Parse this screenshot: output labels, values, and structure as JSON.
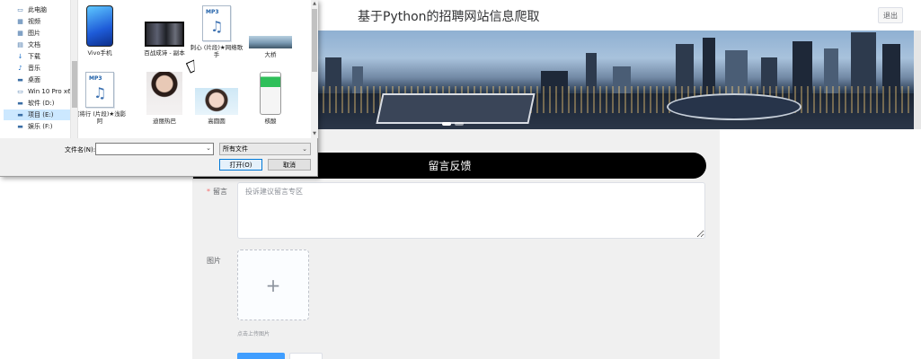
{
  "page": {
    "title": "基于Python的招聘网站信息爬取",
    "logout_label": "退出",
    "feedback_header": "留言反馈",
    "message_label": "留言",
    "required_mark": "*",
    "message_placeholder": "投诉建议留言专区",
    "image_label": "图片",
    "upload_plus": "+",
    "upload_hint": "点击上传图片",
    "banner": {
      "slides": 2,
      "active_slide": 1
    }
  },
  "dialog": {
    "nav_items": [
      {
        "label": "此电脑",
        "icon": "computer-icon",
        "glyph": "▭"
      },
      {
        "label": "视频",
        "icon": "video-folder-icon",
        "glyph": "▦"
      },
      {
        "label": "图片",
        "icon": "pictures-folder-icon",
        "glyph": "▦"
      },
      {
        "label": "文档",
        "icon": "documents-folder-icon",
        "glyph": "▤"
      },
      {
        "label": "下载",
        "icon": "download-icon",
        "glyph": "↓"
      },
      {
        "label": "音乐",
        "icon": "music-icon",
        "glyph": "♪"
      },
      {
        "label": "桌面",
        "icon": "desktop-icon",
        "glyph": "▬"
      },
      {
        "label": "Win 10 Pro x64",
        "icon": "drive-icon",
        "glyph": "▭"
      },
      {
        "label": "软件 (D:)",
        "icon": "drive-icon",
        "glyph": "▬"
      },
      {
        "label": "项目 (E:)",
        "icon": "drive-icon",
        "glyph": "▬"
      },
      {
        "label": "娱乐 (F:)",
        "icon": "drive-icon",
        "glyph": "▬"
      }
    ],
    "selected_nav": "项目 (E:)",
    "files": [
      {
        "name": "Vivo手机",
        "kind": "image-phone"
      },
      {
        "name": "百战成诗 - 副本",
        "kind": "image-video"
      },
      {
        "name": "刺心 (片段)★网络歌手",
        "kind": "mp3"
      },
      {
        "name": "大桥",
        "kind": "image-bridge"
      },
      {
        "name": "盗将行 (片段)★浅影阿",
        "kind": "mp3"
      },
      {
        "name": "迪丽热巴",
        "kind": "image-portrait"
      },
      {
        "name": "高圆圆",
        "kind": "image-portrait2"
      },
      {
        "name": "核酸",
        "kind": "image-phone-green"
      }
    ],
    "filename_label": "文件名(N):",
    "filename_value": "",
    "filetype_value": "所有文件",
    "open_label": "打开(O)",
    "cancel_label": "取消"
  }
}
